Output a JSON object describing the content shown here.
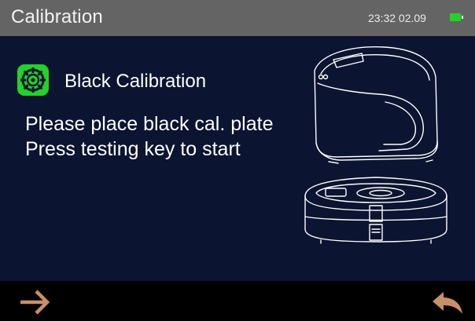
{
  "header": {
    "title": "Calibration",
    "clock": "23:32 02.09",
    "battery_icon": "battery-full-icon",
    "battery_color": "#22d22a"
  },
  "main": {
    "status_icon": "calibration-target-icon",
    "status_icon_color": "#22d22a",
    "heading": "Black Calibration",
    "instructions": [
      "Please place black cal. plate",
      "Press testing key to start"
    ],
    "illustration": "colorimeter-device-on-calibration-base-icon"
  },
  "footer": {
    "next_icon": "arrow-right-icon",
    "back_icon": "return-arrow-icon",
    "button_color": "#c8906a"
  }
}
